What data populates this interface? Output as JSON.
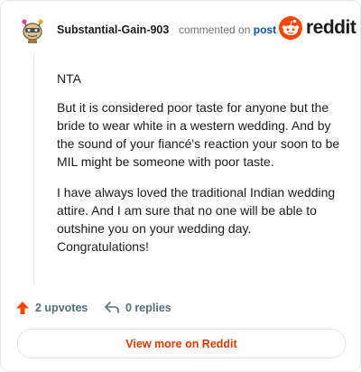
{
  "comment": {
    "author": "Substantial-Gain-903",
    "action_text": "commented on",
    "post_link": "post",
    "paragraphs": [
      "NTA",
      "But it is considered poor taste for anyone but the bride to wear white in a western wedding. And by the sound of your fiancé's reaction your soon to be MIL might be someone with poor taste.",
      "I have always loved the traditional Indian wedding attire. And I am sure that no one will be able to outshine you on your wedding day. Congratulations!"
    ],
    "upvotes_label": "2 upvotes",
    "replies_label": "0 replies"
  },
  "brand": {
    "wordmark": "reddit",
    "icon": "reddit-snoo-icon",
    "color": "#ff4500"
  },
  "footer": {
    "view_more_label": "View more on Reddit",
    "link_color": "#d93a00"
  },
  "icons": {
    "upvote": "upvote-arrow-icon",
    "reply": "reply-arrow-icon",
    "avatar": "user-avatar"
  },
  "colors": {
    "upvote_arrow": "#ff4500",
    "meta_text": "#6b6f73",
    "post_link": "#0b4fa8"
  }
}
